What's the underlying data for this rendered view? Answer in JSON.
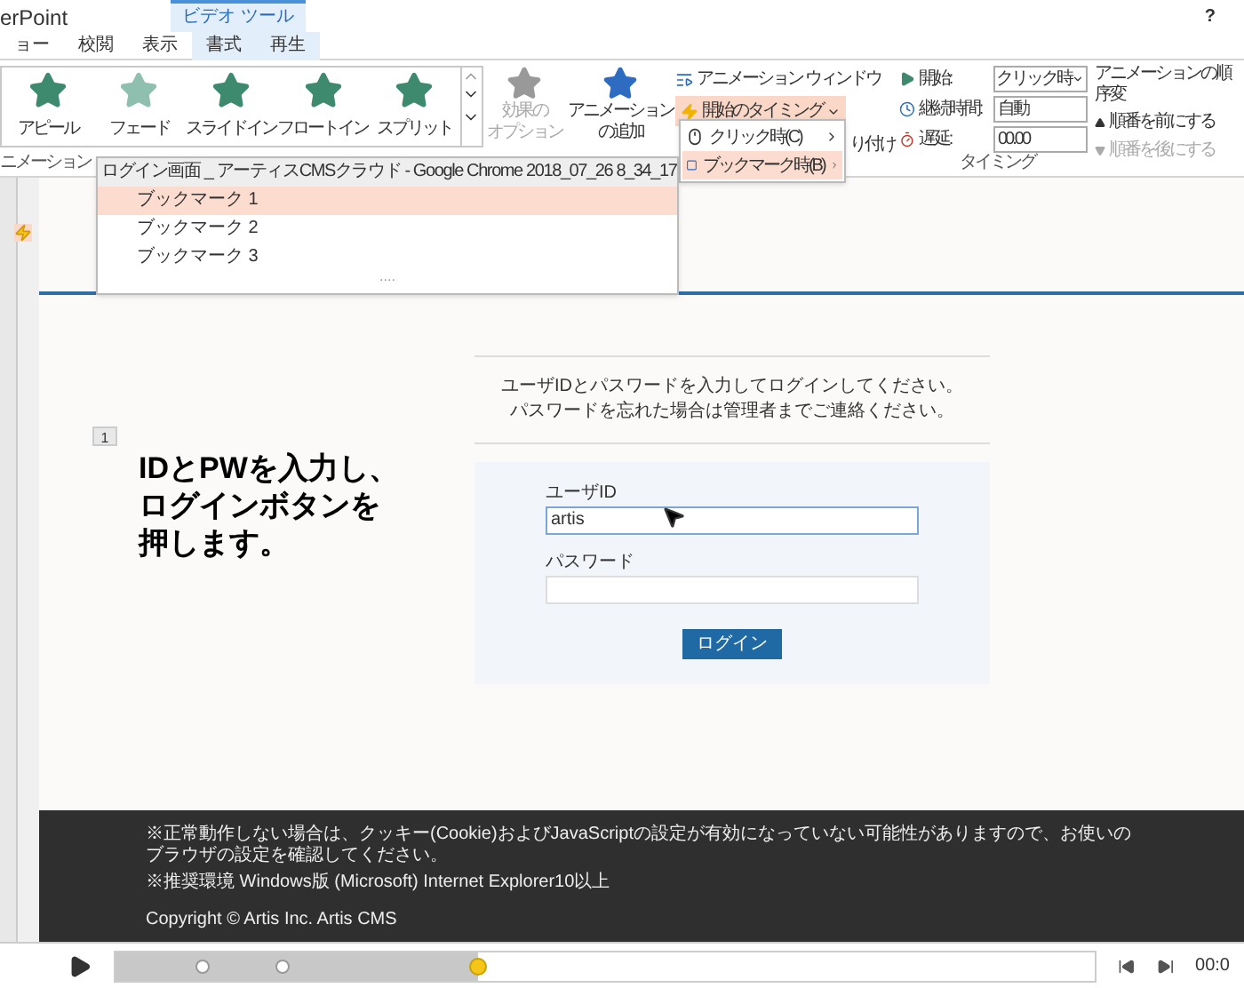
{
  "app_title": "erPoint",
  "contextual_group": "ビデオ ツール",
  "tabs": [
    {
      "label": "ョー",
      "contextual": false
    },
    {
      "label": "校閲",
      "contextual": false
    },
    {
      "label": "表示",
      "contextual": false
    },
    {
      "label": "書式",
      "contextual": true
    },
    {
      "label": "再生",
      "contextual": true
    }
  ],
  "help": "?",
  "gallery": [
    {
      "label": "アピール"
    },
    {
      "label": "フェード"
    },
    {
      "label": "スライドイン"
    },
    {
      "label": "フロートイン"
    },
    {
      "label": "スプリット"
    }
  ],
  "effect_options": {
    "lines": [
      "効果の",
      "オプション"
    ],
    "disabled": true
  },
  "add_animation": {
    "lines": [
      "アニメーション",
      "の追加"
    ]
  },
  "animation_pane": "アニメーション ウィンドウ",
  "trigger_button": {
    "label": "開始のタイミング",
    "active": true
  },
  "hidden_fragment": "り付け",
  "trigger_menu": [
    {
      "label": "クリック時(C)",
      "selected": false,
      "kind": "mouse"
    },
    {
      "label": "ブックマーク時(B)",
      "selected": true,
      "kind": "bookmark"
    }
  ],
  "group_label": "ニメーション",
  "timing": {
    "start_label": "開始:",
    "start_value": "クリック時",
    "duration_label": "継続時間:",
    "duration_value": "自動",
    "delay_label": "遅延:",
    "delay_value": "00.00",
    "group_label": "タイミング"
  },
  "reorder": {
    "title": "アニメーションの順序変",
    "items": [
      {
        "label": "順番を前にする",
        "disabled": false,
        "kind": "up"
      },
      {
        "label": "順番を後にする",
        "disabled": true,
        "kind": "down"
      }
    ]
  },
  "bookmark_menu": {
    "title": "ログイン画面 _ アーティスCMSクラウド - Google Chrome 2018_07_26 8_34_17",
    "items": [
      {
        "label": "ブックマーク 1",
        "selected": true
      },
      {
        "label": "ブックマーク 2",
        "selected": false
      },
      {
        "label": "ブックマーク 3",
        "selected": false
      }
    ],
    "grip": "...."
  },
  "slide": {
    "animation_tag": "1",
    "caption_lines": [
      "IDとPWを入力し、",
      "ログインボタンを",
      "押します。"
    ],
    "instructions": [
      "ユーザIDとパスワードを入力してログインしてください。",
      "パスワードを忘れた場合は管理者までご連絡ください。"
    ],
    "user_label": "ユーザID",
    "user_value": "artis",
    "password_label": "パスワード",
    "login_button": "ログイン",
    "footer_notes": [
      "※正常動作しない場合は、クッキー(Cookie)およびJavaScriptの設定が有効になっていない可能性がありますので、お使いのブラウザの設定を確認してください。",
      "※推奨環境 Windows版 (Microsoft) Internet Explorer10以上"
    ],
    "copyright": "Copyright © Artis Inc. Artis CMS"
  },
  "media": {
    "level": 0.37,
    "time": "00:0"
  }
}
